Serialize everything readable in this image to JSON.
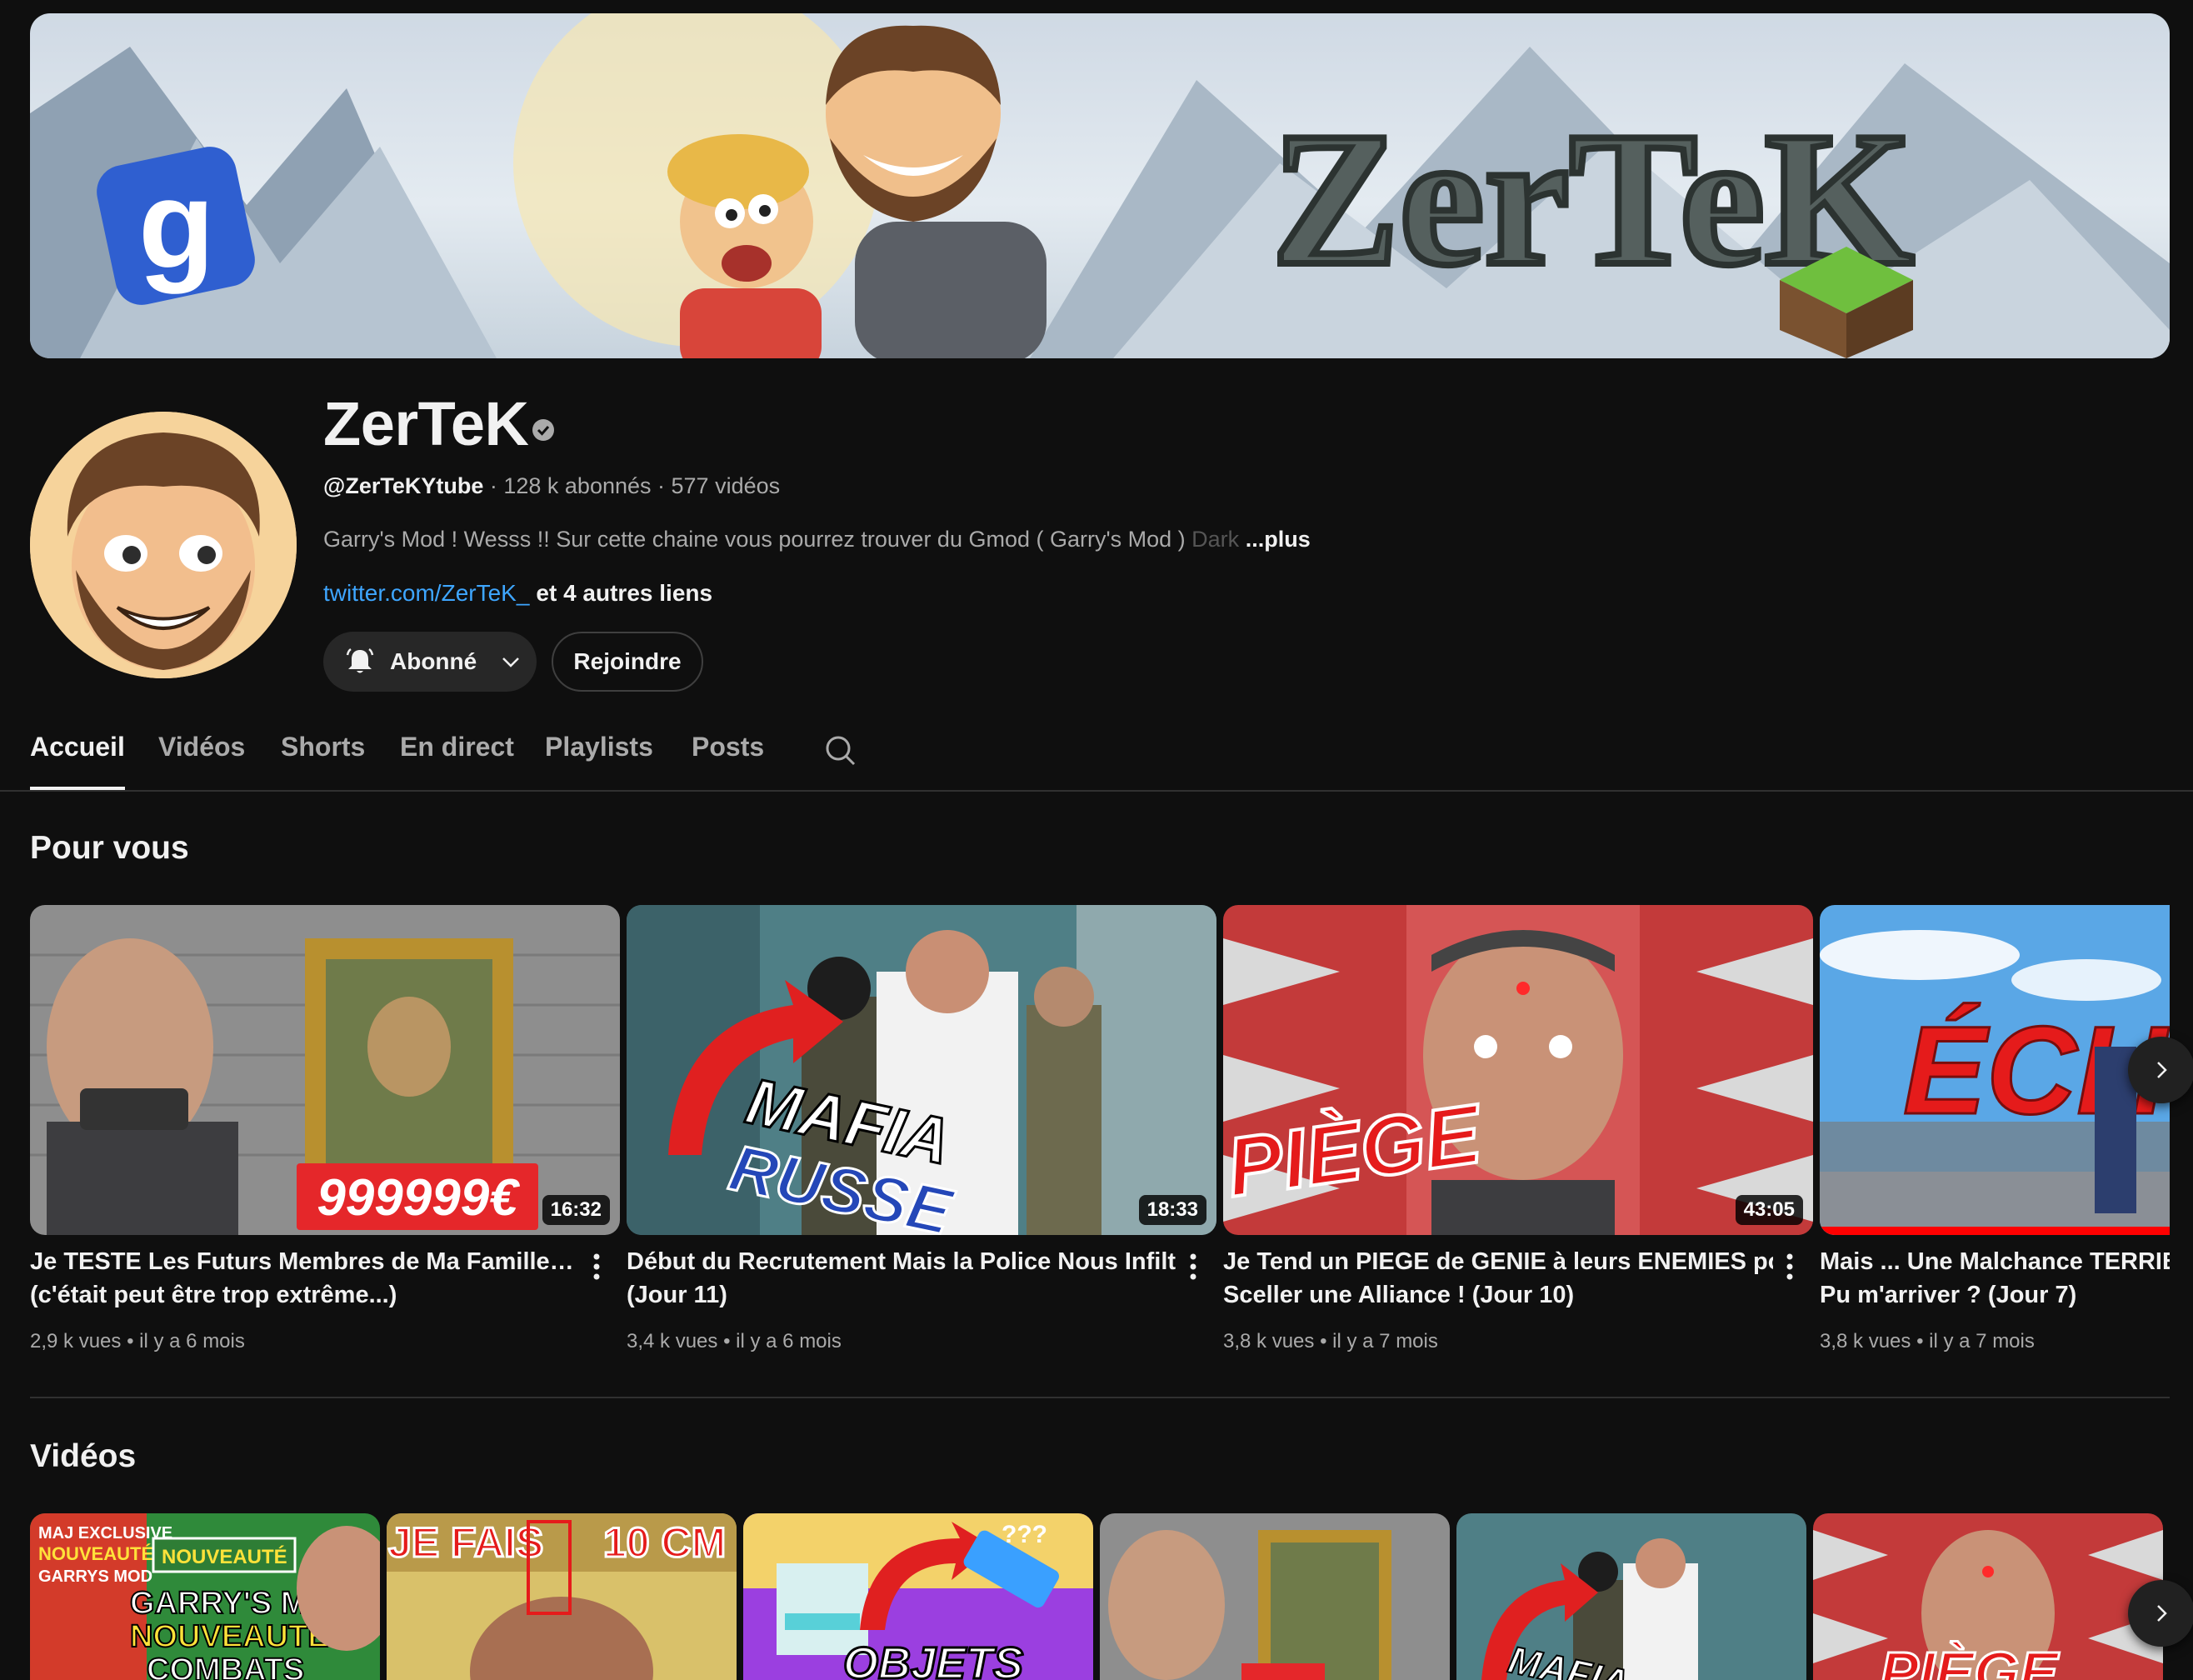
{
  "banner": {
    "title": "ZerTeK"
  },
  "channel": {
    "name": "ZerTeK",
    "handle": "@ZerTeKYtube",
    "sep1": " · ",
    "subscribers": "128 k abonnés",
    "sep2": " · ",
    "videos": "577 vidéos",
    "description": "Garry's Mod ! Wesss !! Sur cette chaine vous pourrez trouver du Gmod ( Garry's Mod ) ",
    "description_fade": "Dark",
    "more_label": "...plus",
    "link": "twitter.com/ZerTeK_",
    "other_links": "et 4 autres liens",
    "subscribe_label": "Abonné",
    "join_label": "Rejoindre"
  },
  "tabs": [
    {
      "label": "Accueil",
      "active": true
    },
    {
      "label": "Vidéos"
    },
    {
      "label": "Shorts"
    },
    {
      "label": "En direct"
    },
    {
      "label": "Playlists"
    },
    {
      "label": "Posts"
    }
  ],
  "sections": {
    "for_you": {
      "title": "Pour vous",
      "cards": [
        {
          "title_line1": "Je TESTE Les Futurs Membres de Ma Famille…",
          "title_line2": "(c'était peut être trop extrême...)",
          "duration": "16:32",
          "views": "2,9 k vues",
          "age": "il y a 6 mois",
          "thumb_text": "999999€"
        },
        {
          "title_line1": "Début du Recrutement Mais la Police Nous Infiltre ?!",
          "title_line2": "(Jour 11)",
          "duration": "18:33",
          "views": "3,4 k vues",
          "age": "il y a 6 mois",
          "thumb_text": "MAFIA",
          "thumb_text2": "RUSSE"
        },
        {
          "title_line1": "Je Tend un PIEGE de GENIE à leurs ENEMIES pour",
          "title_line2": "Sceller une Alliance ! (Jour 10)",
          "duration": "43:05",
          "views": "3,8 k vues",
          "age": "il y a 7 mois",
          "thumb_text": "PIÈGE"
        },
        {
          "title_line1": "Mais ... Une Malchance TERRIBLE",
          "title_line2": "Pu m'arriver ? (Jour 7)",
          "duration": "",
          "views": "3,8 k vues",
          "age": "il y a 7 mois",
          "thumb_text": "ÉCH"
        }
      ],
      "meta_sep": "•"
    },
    "videos": {
      "title": "Vidéos",
      "thumbs": [
        {
          "text1": "MAJ EXCLUSIVE",
          "text2": "NOUVEAUTÉ",
          "text3": "GARRYS MOD",
          "text4": "GARRY'S MOD",
          "text5": "NOUVEAUTE",
          "text6": "COMBATS",
          "badge": "NOUVEAUTÉ"
        },
        {
          "text1": "JE FAIS",
          "text2": "10 CM"
        },
        {
          "text1": "OBJETS",
          "text2": "???"
        },
        {
          "text1": ""
        },
        {
          "text1": "MAFIA"
        },
        {
          "text1": "PIÈGE"
        }
      ]
    }
  },
  "colors": {
    "background": "#0f0f0f",
    "link": "#3ea6ff",
    "text_secondary": "#aaaaaa",
    "progress": "#ff0000"
  }
}
